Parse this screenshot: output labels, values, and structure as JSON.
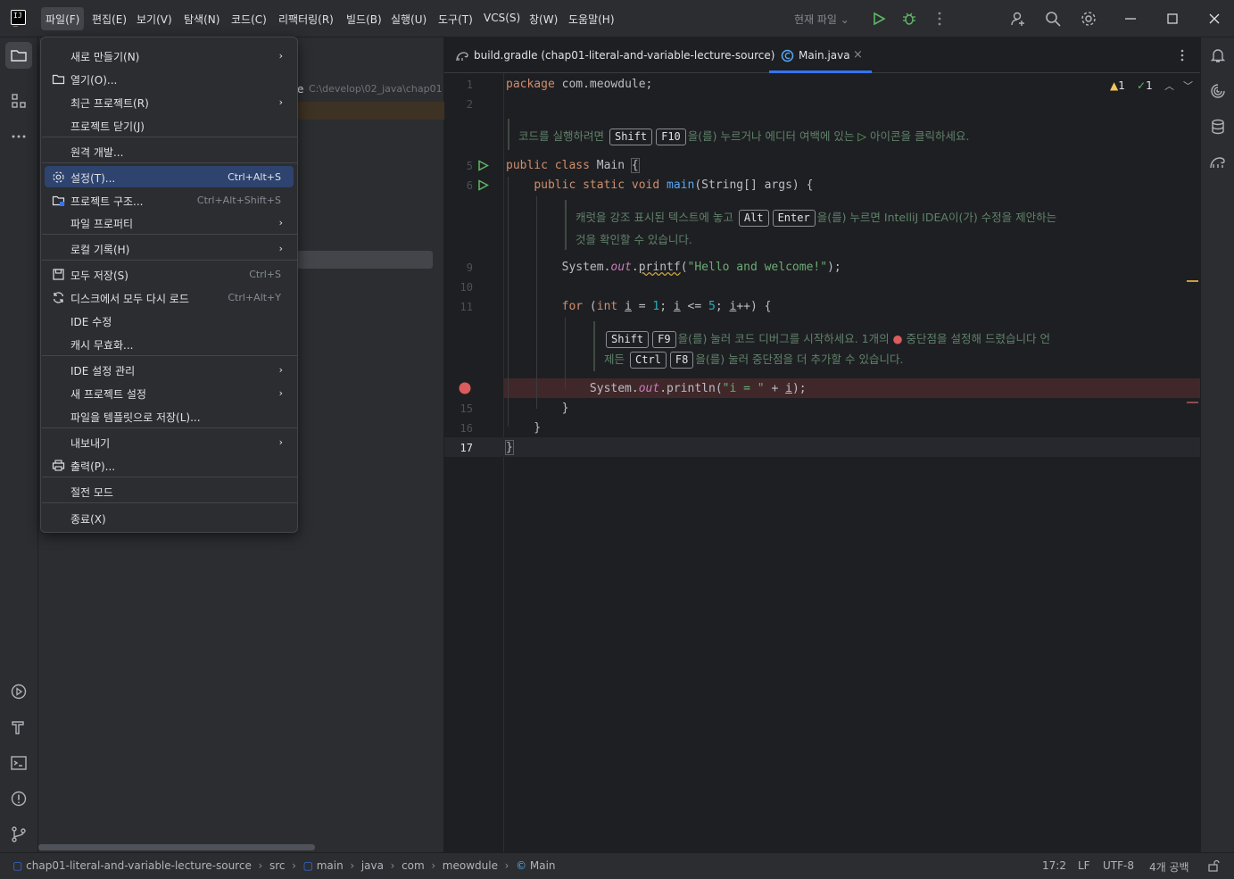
{
  "menubar": {
    "items": [
      "파일(F)",
      "편집(E)",
      "보기(V)",
      "탐색(N)",
      "코드(C)",
      "리팩터링(R)",
      "빌드(B)",
      "실행(U)",
      "도구(T)",
      "VCS(S)",
      "창(W)",
      "도움말(H)"
    ],
    "run_config": "현재 파일"
  },
  "project": {
    "path_prefix": "e",
    "path": "C:\\develop\\02_java\\chap01"
  },
  "tabs": [
    {
      "label": "build.gradle (chap01-literal-and-variable-lecture-source)"
    },
    {
      "label": "Main.java"
    }
  ],
  "inspections": {
    "warnings": "1",
    "checks": "1"
  },
  "editor": {
    "line_numbers": [
      "1",
      "2",
      "5",
      "6",
      "9",
      "10",
      "11",
      "15",
      "16",
      "17"
    ],
    "hint1": {
      "pre": "코드를 실행하려면",
      "k1": "Shift",
      "k2": "F10",
      "post": "을(를) 누르거나 에디터 여백에 있는",
      "post2": "아이콘을 클릭하세요."
    },
    "hint2": {
      "pre": "캐럿을 강조 표시된 텍스트에 놓고",
      "k1": "Alt",
      "k2": "Enter",
      "post": "을(를) 누르면 IntelliJ IDEA이(가) 수정을 제안하는",
      "line2": "것을 확인할 수 있습니다."
    },
    "hint3": {
      "k1": "Shift",
      "k2": "F9",
      "post": "을(를) 눌러 코드 디버그를 시작하세요. 1개의",
      "post2": "중단점을 설정해 드렸습니다 언",
      "line2pre": "제든",
      "k3": "Ctrl",
      "k4": "F8",
      "line2post": "을(를) 눌러 중단점을 더 추가할 수 있습니다."
    }
  },
  "file_menu": {
    "items": [
      {
        "label": "새로 만들기(N)",
        "submenu": true
      },
      {
        "label": "열기(O)...",
        "icon": "folder-icon"
      },
      {
        "label": "최근 프로젝트(R)",
        "submenu": true
      },
      {
        "label": "프로젝트 닫기(J)"
      },
      {
        "label": "원격 개발..."
      },
      {
        "label": "설정(T)...",
        "shortcut": "Ctrl+Alt+S",
        "icon": "gear-icon",
        "highlighted": true
      },
      {
        "label": "프로젝트 구조...",
        "shortcut": "Ctrl+Alt+Shift+S",
        "icon": "project-structure-icon"
      },
      {
        "label": "파일 프로퍼티",
        "submenu": true
      },
      {
        "label": "로컬 기록(H)",
        "submenu": true
      },
      {
        "label": "모두 저장(S)",
        "shortcut": "Ctrl+S",
        "icon": "save-icon"
      },
      {
        "label": "디스크에서 모두 다시 로드",
        "shortcut": "Ctrl+Alt+Y",
        "icon": "reload-icon"
      },
      {
        "label": "IDE 수정"
      },
      {
        "label": "캐시 무효화..."
      },
      {
        "label": "IDE 설정 관리",
        "submenu": true
      },
      {
        "label": "새 프로젝트 설정",
        "submenu": true
      },
      {
        "label": "파일을 템플릿으로 저장(L)..."
      },
      {
        "label": "내보내기",
        "submenu": true
      },
      {
        "label": "출력(P)...",
        "icon": "print-icon"
      },
      {
        "label": "절전 모드"
      },
      {
        "label": "종료(X)"
      }
    ]
  },
  "statusbar": {
    "breadcrumbs": [
      "chap01-literal-and-variable-lecture-source",
      "src",
      "main",
      "java",
      "com",
      "meowdule",
      "Main"
    ],
    "position": "17:2",
    "line_sep": "LF",
    "encoding": "UTF-8",
    "indent": "4개 공백"
  },
  "colors": {
    "accent": "#3574f0",
    "menu_highlight": "#2e436e",
    "breakpoint": "#db5c5c",
    "run_gutter": "#5fb865"
  }
}
